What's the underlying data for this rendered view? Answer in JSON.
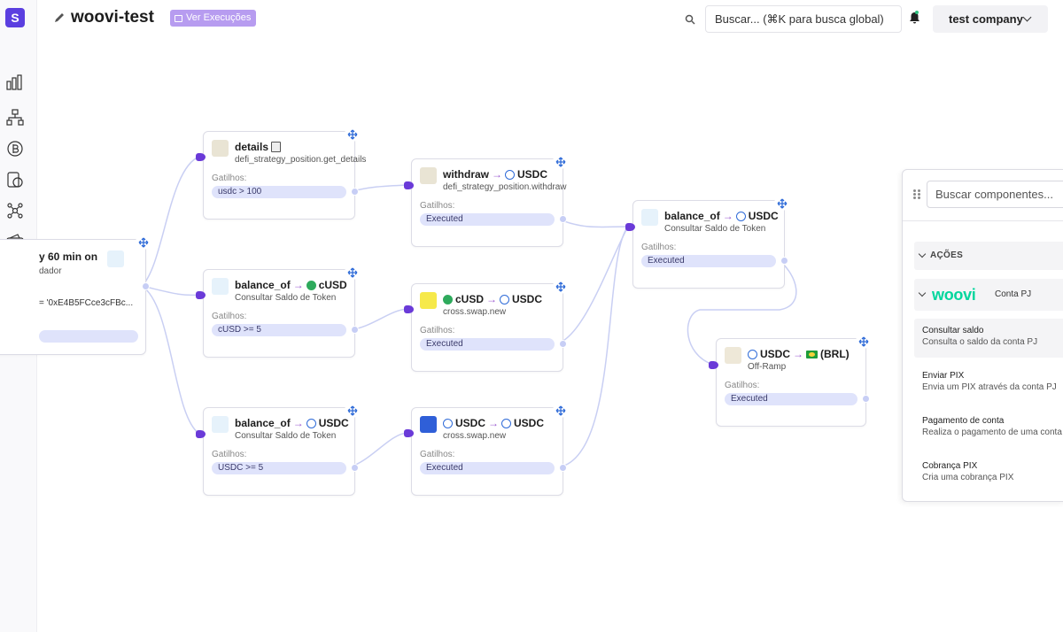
{
  "app": {
    "logo_letter": "S",
    "title": "woovi-test",
    "executions_label": "Ver Execuções",
    "search_placeholder": "Buscar... (⌘K para busca global)",
    "company": "test company"
  },
  "sidebar": {
    "icons": [
      "dashboard-icon",
      "flow-icon",
      "bitcoin-icon",
      "bitcoin-doc-icon",
      "network-icon",
      "wallet-icon",
      "people-icon",
      "cube-icon",
      "user-network-icon"
    ]
  },
  "nodes": {
    "trigger": {
      "title": "y 60 min on",
      "subtitle": "dador",
      "value": "= '0xE4B5FCce3cFBc...",
      "pill": ""
    },
    "details": {
      "title": "details",
      "subtitle": "defi_strategy_position.get_details",
      "gatilhos": "Gatilhos:",
      "pill": "usdc > 100"
    },
    "balance_cusd": {
      "title_a": "balance_of",
      "title_b": "cUSD",
      "subtitle": "Consultar Saldo de Token",
      "gatilhos": "Gatilhos:",
      "pill": "cUSD >= 5"
    },
    "balance_usdc": {
      "title_a": "balance_of",
      "title_b": "USDC",
      "subtitle": "Consultar Saldo de Token",
      "gatilhos": "Gatilhos:",
      "pill": "USDC >= 5"
    },
    "withdraw": {
      "title_a": "withdraw",
      "title_b": "USDC",
      "subtitle": "defi_strategy_position.withdraw",
      "gatilhos": "Gatilhos:",
      "pill": "Executed"
    },
    "swap_cusd": {
      "title_a": "cUSD",
      "title_b": "USDC",
      "subtitle": "cross.swap.new",
      "gatilhos": "Gatilhos:",
      "pill": "Executed"
    },
    "swap_usdc": {
      "title_a": "USDC",
      "title_b": "USDC",
      "subtitle": "cross.swap.new",
      "gatilhos": "Gatilhos:",
      "pill": "Executed"
    },
    "balance_final": {
      "title_a": "balance_of",
      "title_b": "USDC",
      "subtitle": "Consultar Saldo de Token",
      "gatilhos": "Gatilhos:",
      "pill": "Executed"
    },
    "offramp": {
      "title_a": "USDC",
      "title_b": "(BRL)",
      "subtitle": "Off-Ramp",
      "gatilhos": "Gatilhos:",
      "pill": "Executed"
    }
  },
  "panel": {
    "search_placeholder": "Buscar componentes...",
    "section": "AÇÕES",
    "provider_logo": "woovi",
    "provider_label": "Conta PJ",
    "items": [
      {
        "title": "Consultar saldo",
        "desc": "Consulta o saldo da conta PJ"
      },
      {
        "title": "Enviar PIX",
        "desc": "Envia um PIX através da conta PJ"
      },
      {
        "title": "Pagamento de conta",
        "desc": "Realiza o pagamento de uma conta"
      },
      {
        "title": "Cobrança PIX",
        "desc": "Cria uma cobrança PIX"
      }
    ]
  },
  "colors": {
    "accent": "#5b3fe0",
    "edge": "#c9cff3",
    "pill": "#dfe3fb",
    "arrow": "#9b59d0",
    "woovi": "#03d69d"
  }
}
